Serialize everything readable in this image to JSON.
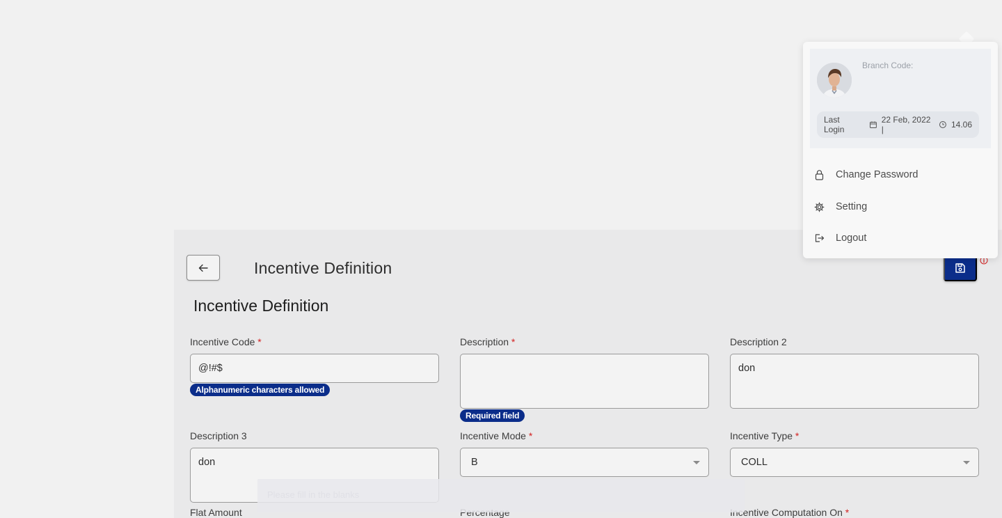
{
  "page": {
    "header_title": "Incentive Definition",
    "section_title": "Incentive Definition"
  },
  "fields": {
    "incentive_code": {
      "label": "Incentive Code",
      "required": "*",
      "value": "@!#$",
      "error": "Alphanumeric characters allowed"
    },
    "description": {
      "label": "Description",
      "required": "*",
      "value": "",
      "error": "Required field"
    },
    "description2": {
      "label": "Description 2",
      "value": "don"
    },
    "description3": {
      "label": "Description 3",
      "value": "don"
    },
    "incentive_mode": {
      "label": "Incentive Mode",
      "required": "*",
      "value": "B"
    },
    "incentive_type": {
      "label": "Incentive Type",
      "required": "*",
      "value": "COLL"
    },
    "flat_amount": {
      "label": "Flat Amount"
    },
    "percentage": {
      "label": "Percentage"
    },
    "incentive_computation_on": {
      "label": "Incentive Computation On",
      "required": "*"
    }
  },
  "toast": {
    "text": "Please fill in the blanks"
  },
  "profile_menu": {
    "branch_code_label": "Branch Code:",
    "last_login_label": "Last Login",
    "last_login_date": "22 Feb, 2022 |",
    "last_login_time": "14.06",
    "items": [
      {
        "label": "Change Password",
        "icon": "lock-icon"
      },
      {
        "label": "Setting",
        "icon": "gear-icon"
      },
      {
        "label": "Logout",
        "icon": "logout-icon"
      }
    ]
  },
  "colors": {
    "primary": "#0b2d8a",
    "required": "#d32222",
    "info": "#d32222"
  }
}
